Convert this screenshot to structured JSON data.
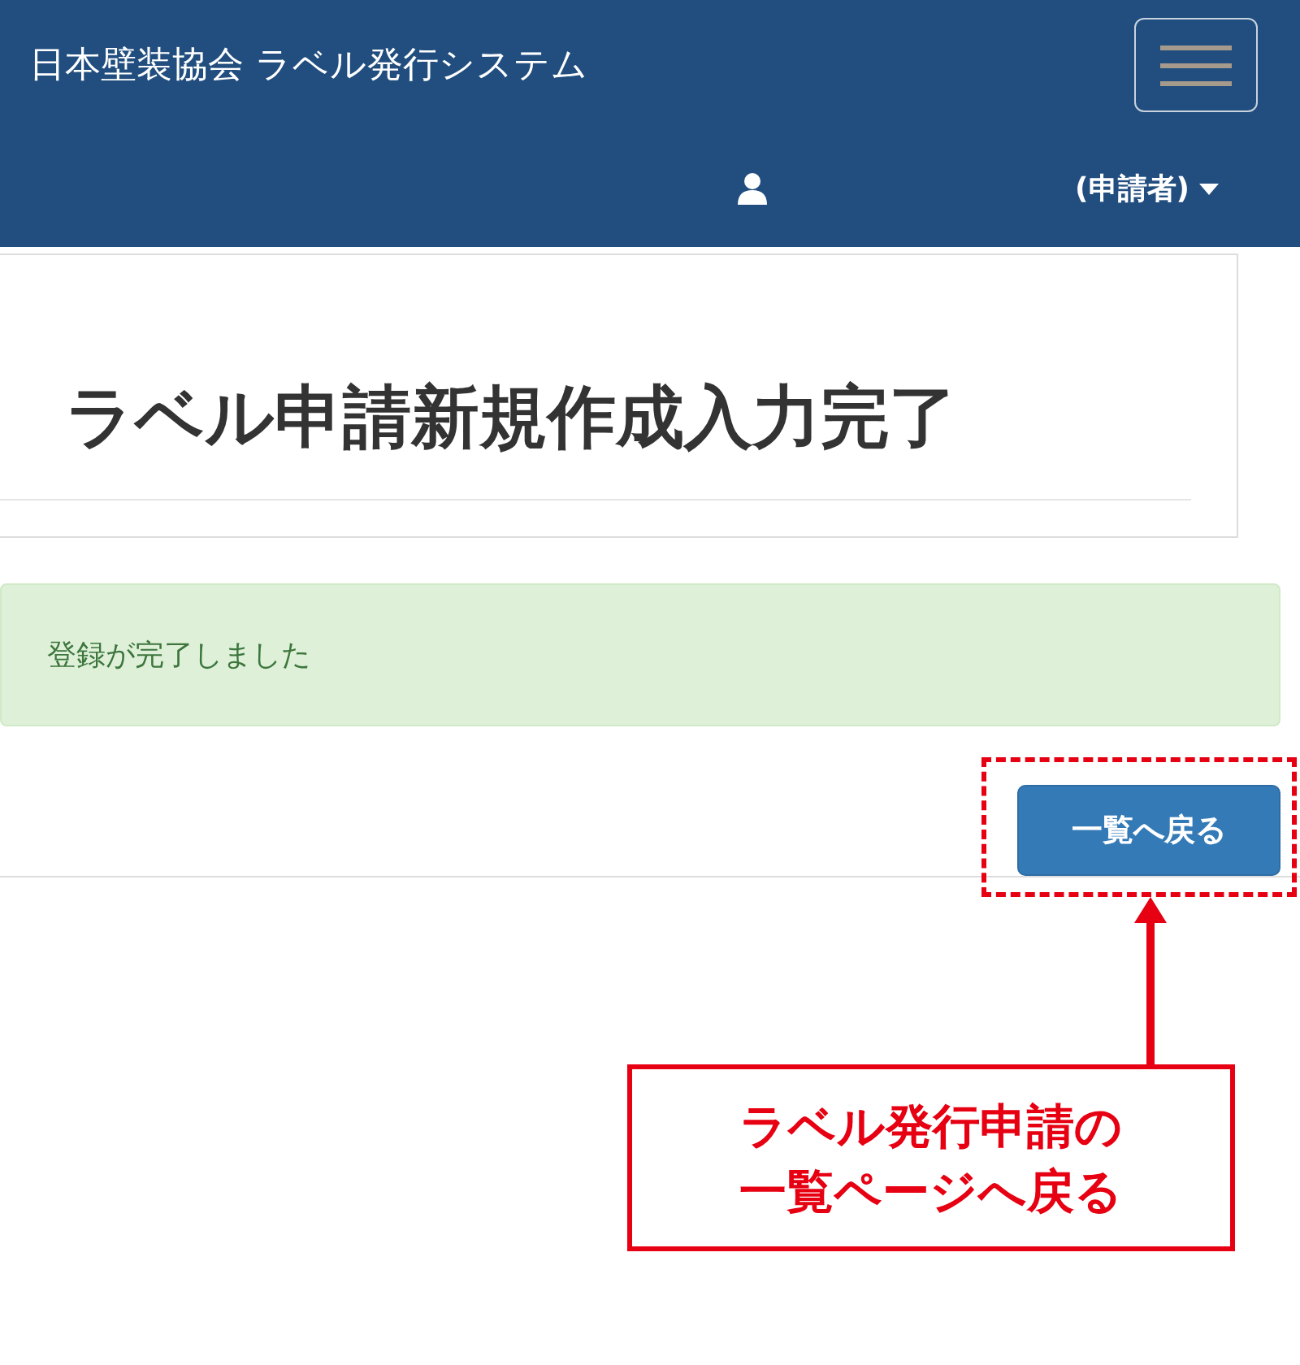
{
  "navbar": {
    "brand": "日本壁装協会 ラベル発行システム",
    "user_menu": "(申請者)"
  },
  "page": {
    "heading": "ラベル申請新規作成入力完了"
  },
  "alert": {
    "message": "登録が完了しました"
  },
  "buttons": [
    "一覧へ戻る"
  ],
  "annotation": {
    "lines": [
      "ラベル発行申請の",
      "一覧ページへ戻る"
    ]
  }
}
